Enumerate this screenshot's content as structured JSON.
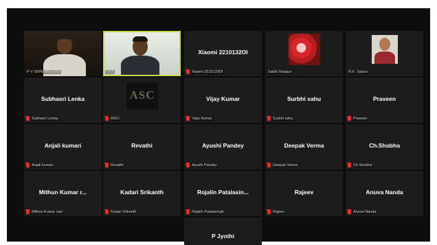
{
  "participants": [
    {
      "name": "",
      "label": "P V SRINIVAS RAO"
    },
    {
      "name": "",
      "label": "GSS"
    },
    {
      "name": "Xiaomi 2210132OI",
      "label": "Xiaomi 2210132OI"
    },
    {
      "name": "",
      "label": "Sakib Shaque"
    },
    {
      "name": "",
      "label": "N.K. Sahoo"
    },
    {
      "name": "Subhasri Lenka",
      "label": "Subhasri Lenka"
    },
    {
      "name": "ASC",
      "label": "ASCI"
    },
    {
      "name": "Vijay Kumar",
      "label": "Vijay Kumar"
    },
    {
      "name": "Surbhi sahu",
      "label": "Surbhi sahu"
    },
    {
      "name": "Praveen",
      "label": "Praveen"
    },
    {
      "name": "Anjali kumari",
      "label": "Anjali kumari"
    },
    {
      "name": "Revathi",
      "label": "Revathi"
    },
    {
      "name": "Ayushi Pandey",
      "label": "Ayushi Pandey"
    },
    {
      "name": "Deepak Verma",
      "label": "Deepak Verma"
    },
    {
      "name": "Ch.Shobha",
      "label": "Ch.Shobha"
    },
    {
      "name": "Mithun Kumar r...",
      "label": "Mithun Kumar raoi"
    },
    {
      "name": "Kadari Srikanth",
      "label": "Kadari Srikanth"
    },
    {
      "name": "Rojalin Patalasin...",
      "label": "Rojalin Patalasingh"
    },
    {
      "name": "Rajeev",
      "label": "Rajeev"
    },
    {
      "name": "Anuva Nanda",
      "label": "Anuva Nanda"
    },
    {
      "name": "P Jyothi",
      "label": ""
    }
  ],
  "colors": {
    "active_border": "#c6d94a",
    "muted_mic": "#e0332b",
    "tile_bg": "#1c1c1c"
  }
}
